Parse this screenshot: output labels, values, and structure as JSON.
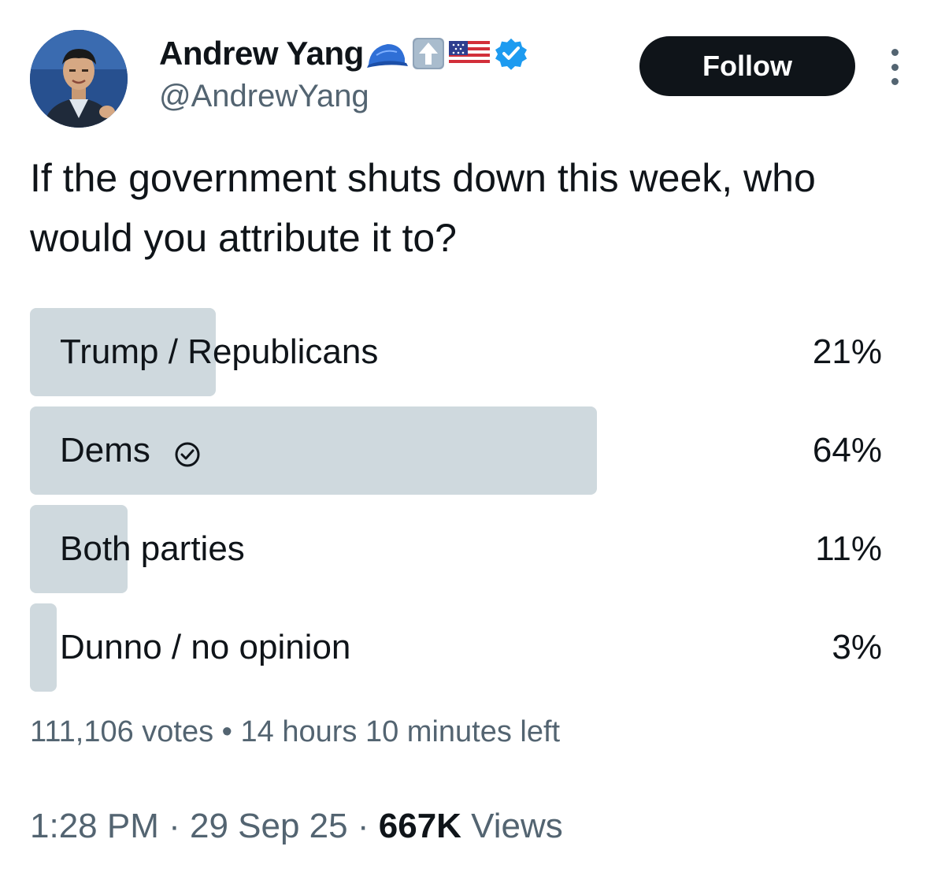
{
  "author": {
    "display_name": "Andrew Yang",
    "handle": "@AndrewYang",
    "name_emojis": [
      "blue-cap-icon",
      "up-arrow-icon",
      "us-flag-icon"
    ],
    "verified": true,
    "verified_color": "#1d9bf0"
  },
  "actions": {
    "follow_label": "Follow"
  },
  "tweet": {
    "text": "If the government shuts down this week, who would you attribute it to?"
  },
  "poll": {
    "options": [
      {
        "label": "Trump / Republicans",
        "percent_label": "21%",
        "percent": 21,
        "selected": false
      },
      {
        "label": "Dems",
        "percent_label": "64%",
        "percent": 64,
        "selected": true
      },
      {
        "label": "Both parties",
        "percent_label": "11%",
        "percent": 11,
        "selected": false
      },
      {
        "label": "Dunno / no opinion",
        "percent_label": "3%",
        "percent": 3,
        "selected": false
      }
    ],
    "votes": "111,106 votes",
    "separator": "•",
    "time_left": "14 hours 10 minutes left"
  },
  "meta": {
    "time": "1:28 PM",
    "date": "29 Sep 25",
    "separator": "·",
    "views_count": "667K",
    "views_label": "Views"
  },
  "colors": {
    "text_primary": "#0f1419",
    "text_secondary": "#536471",
    "poll_bar": "#cfd9de",
    "button_bg": "#0f1419"
  }
}
